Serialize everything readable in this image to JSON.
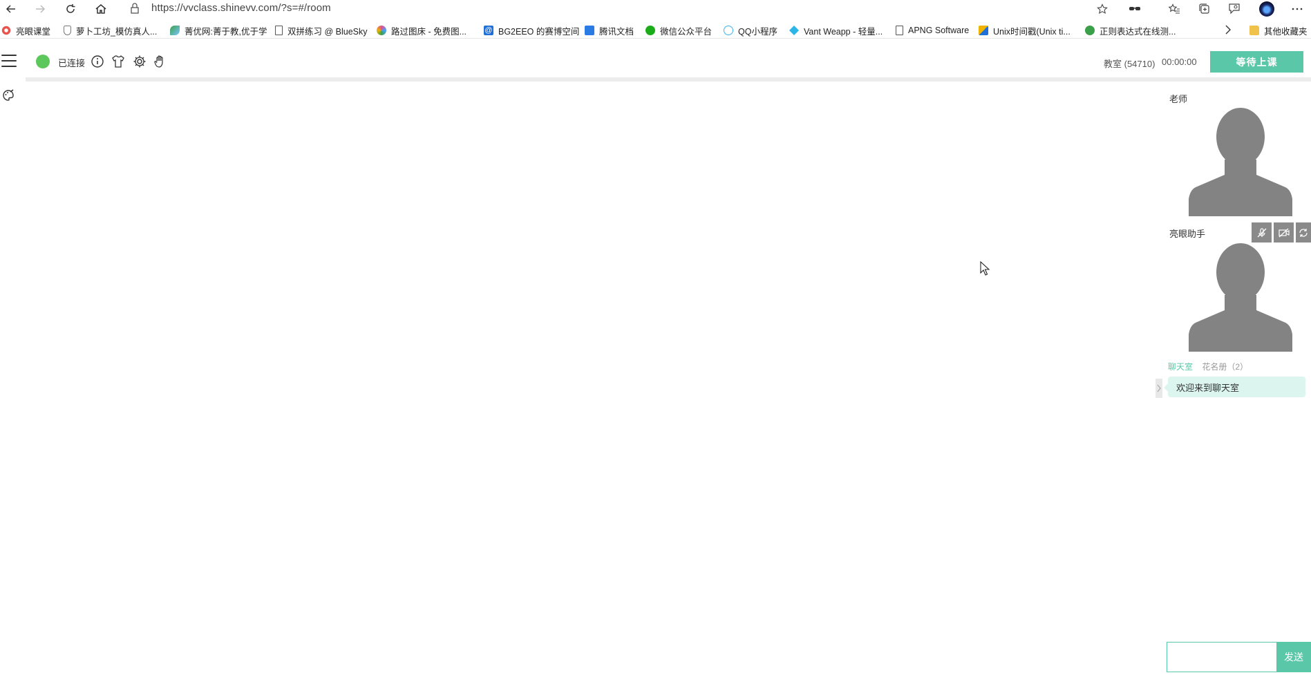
{
  "browser": {
    "url": "https://vvclass.shinevv.com/?s=#/room",
    "bookmarks": [
      {
        "label": "亮眼课堂",
        "color": "#e8544d"
      },
      {
        "label": "萝卜工坊_模仿真人...",
        "color": "#777777"
      },
      {
        "label": "菁优网:菁于教,优于学",
        "color": "#3aa04a"
      },
      {
        "label": "双拼练习 @ BlueSky",
        "color": "#666666"
      },
      {
        "label": "路过图床 - 免费图...",
        "color": "#e0508a"
      },
      {
        "label": "BG2EEO 的赛博空间",
        "color": "#1e6fd8"
      },
      {
        "label": "腾讯文档",
        "color": "#2a7be4"
      },
      {
        "label": "微信公众平台",
        "color": "#1aad19"
      },
      {
        "label": "QQ小程序",
        "color": "#3ab3f0"
      },
      {
        "label": "Vant Weapp - 轻量...",
        "color": "#2bb5e8"
      },
      {
        "label": "APNG Software",
        "color": "#666666"
      },
      {
        "label": "Unix时间戳(Unix ti...",
        "color": "#f0b400"
      },
      {
        "label": "正则表达式在线测...",
        "color": "#3aa04a"
      }
    ],
    "other_bookmarks": "其他收藏夹"
  },
  "app": {
    "status": "已连接",
    "status_color": "#5cc85c",
    "accent_color": "#5ac8a8",
    "room_info": "教室 (54710)",
    "timer": "00:00:00",
    "wait_button": "等待上课",
    "tools": [
      "info-icon",
      "shirt-icon",
      "gear-icon",
      "hand-icon"
    ]
  },
  "panel": {
    "teacher_label": "老师",
    "assistant_label": "亮眼助手"
  },
  "chat": {
    "tab_chat": "聊天室",
    "tab_roster": "花名册（2）",
    "welcome": "欢迎来到聊天室",
    "input_value": "",
    "send": "发送"
  }
}
